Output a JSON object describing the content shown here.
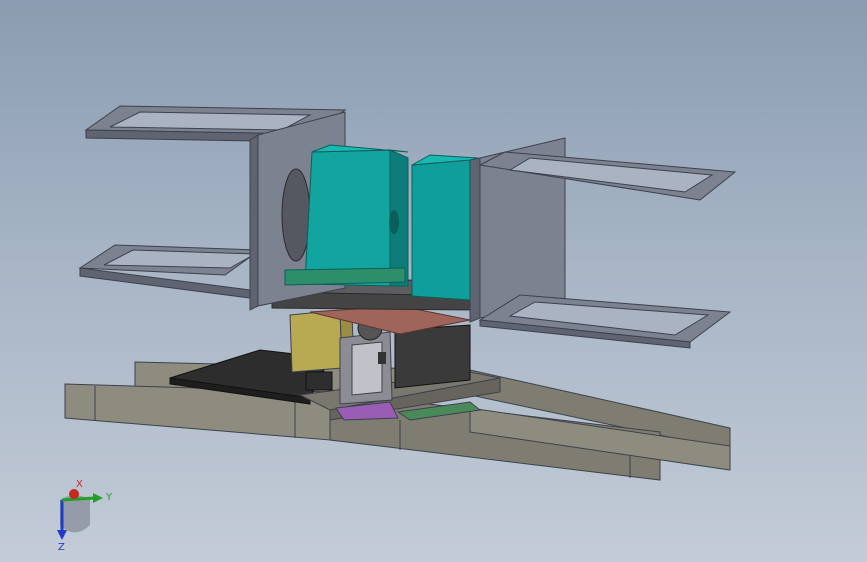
{
  "viewport": {
    "background_top": "#8b9cb1",
    "background_bottom": "#c3ccd7"
  },
  "model": {
    "colors": {
      "frame_plate": "#7d8290",
      "frame_edge": "#3d414c",
      "rail": "#8e8b7f",
      "rail_dark": "#6b695f",
      "motor_teal": "#12a5a0",
      "motor_teal_dark": "#0c7d7a",
      "gear_red": "#a0655a",
      "motor_olive": "#b8aa52",
      "pcb_dark": "#2d2d2d",
      "purple_part": "#9a5db5",
      "green_part": "#4a8a5a"
    }
  },
  "triad": {
    "labels": {
      "x": "X",
      "y": "Y",
      "z": "Z"
    },
    "colors": {
      "x": "#c8281e",
      "y": "#22a02a",
      "z": "#1e3cc8"
    }
  }
}
